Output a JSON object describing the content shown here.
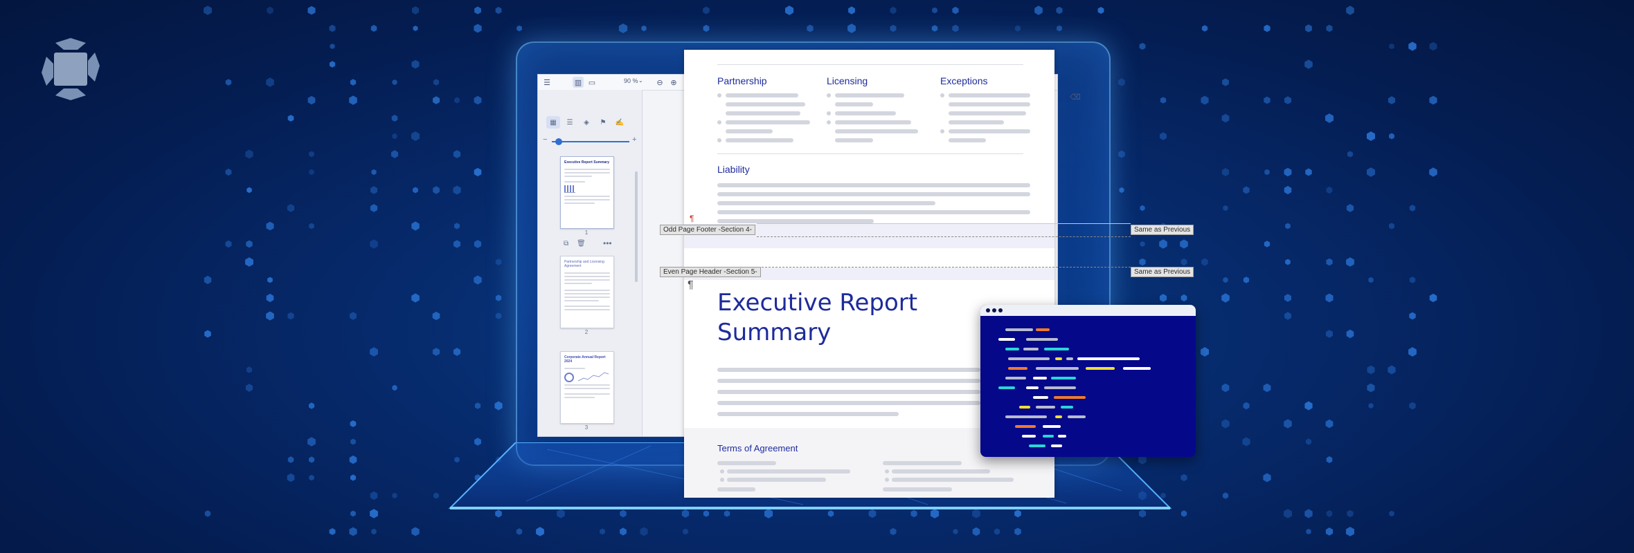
{
  "colors": {
    "bg": "#041c4f",
    "accent": "#1e2b9b",
    "code_bg": "#06088a",
    "code_colors": [
      "#b8bccc",
      "#f07a2e",
      "#2ad6d6",
      "#f0e030",
      "#ffffff"
    ]
  },
  "toolbar": {
    "zoom_value": "90 %",
    "icons": [
      "menu-icon",
      "sidebar-toggle-icon",
      "page-icon",
      "zoom-out-icon",
      "zoom-in-icon",
      "eraser-icon"
    ]
  },
  "sidebar": {
    "tabs": [
      "thumbnails-icon",
      "list-icon",
      "layers-icon",
      "bookmark-icon",
      "signature-icon"
    ],
    "thumbnails": [
      {
        "title": "Executive Report Summary",
        "page": "1"
      },
      {
        "title": "Partnership and Licensing Agreement",
        "page": "2"
      },
      {
        "title": "Corporate Annual Report 2024",
        "page": "3"
      }
    ]
  },
  "document": {
    "sections": {
      "partnership": "Partnership",
      "licensing": "Licensing",
      "exceptions": "Exceptions",
      "liability": "Liability"
    },
    "odd_footer_label": "Odd Page Footer -Section 4-",
    "even_header_label": "Even Page Header -Section 5-",
    "same_as_previous_1": "Same as Previous",
    "same_as_previous_2": "Same as Previous",
    "title_line1": "Executive Report",
    "title_line2": "Summary",
    "terms_heading": "Terms of Agreement"
  }
}
